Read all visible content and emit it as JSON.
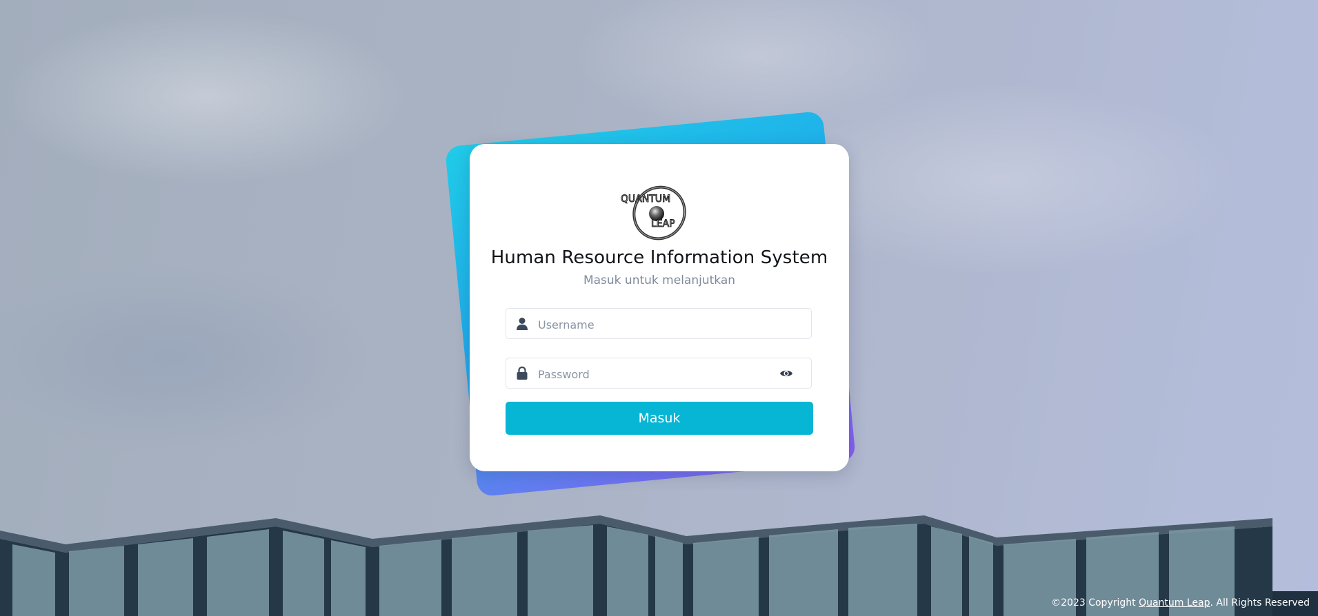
{
  "brand": {
    "logo_line1": "QUANTUM",
    "logo_line2": "LEAP"
  },
  "login": {
    "title": "Human Resource Information System",
    "subtitle": "Masuk untuk melanjutkan",
    "username_placeholder": "Username",
    "username_value": "",
    "password_placeholder": "Password",
    "password_value": "",
    "submit_label": "Masuk"
  },
  "footer": {
    "prefix": "©2023 Copyright ",
    "link_text": "Quantum Leap",
    "suffix": ". All Rights Reserved"
  },
  "icons": {
    "username": "user-icon",
    "password": "lock-icon",
    "toggle_password": "eye-icon"
  },
  "colors": {
    "primary_button": "#06b6d4",
    "card_accent_start": "#20cbe8",
    "card_accent_end": "#8a5bf2"
  }
}
